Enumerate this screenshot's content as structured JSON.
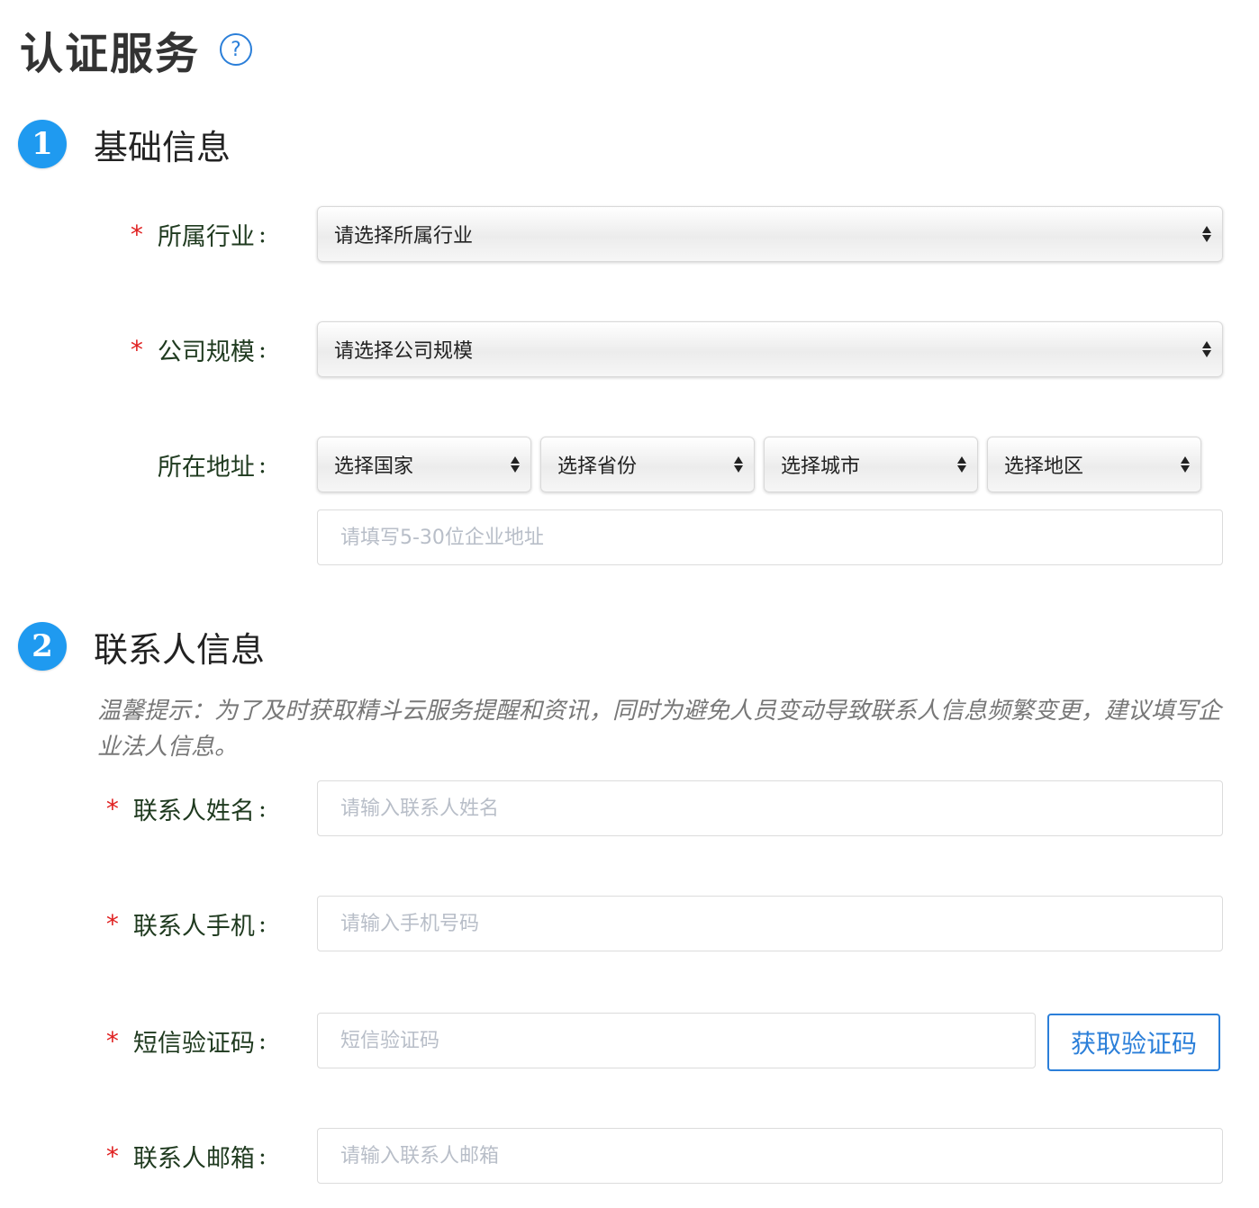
{
  "page_title": "认证服务",
  "help_icon": "?",
  "sections": [
    {
      "step": "1",
      "title": "基础信息"
    },
    {
      "step": "2",
      "title": "联系人信息"
    }
  ],
  "basic": {
    "industry": {
      "required": "*",
      "label": "所属行业",
      "colon": ":",
      "value": "请选择所属行业"
    },
    "scale": {
      "required": "*",
      "label": "公司规模",
      "colon": ":",
      "value": "请选择公司规模"
    },
    "address": {
      "label": "所在地址",
      "colon": ":",
      "country": "选择国家",
      "province": "选择省份",
      "city": "选择城市",
      "district": "选择地区",
      "detail_placeholder": "请填写5-30位企业地址"
    }
  },
  "contact": {
    "tip": "温馨提示：为了及时获取精斗云服务提醒和资讯，同时为避免人员变动导致联系人信息频繁变更，建议填写企业法人信息。",
    "name": {
      "required": "*",
      "label": "联系人姓名",
      "colon": ":",
      "placeholder": "请输入联系人姓名"
    },
    "phone": {
      "required": "*",
      "label": "联系人手机",
      "colon": ":",
      "placeholder": "请输入手机号码"
    },
    "sms": {
      "required": "*",
      "label": "短信验证码",
      "colon": ":",
      "placeholder": "短信验证码",
      "button": "获取验证码"
    },
    "email": {
      "required": "*",
      "label": "联系人邮箱",
      "colon": ":",
      "placeholder": "请输入联系人邮箱"
    }
  },
  "colors": {
    "accent": "#2b7fd9",
    "step": "#1f9af0",
    "required": "#e02020"
  }
}
